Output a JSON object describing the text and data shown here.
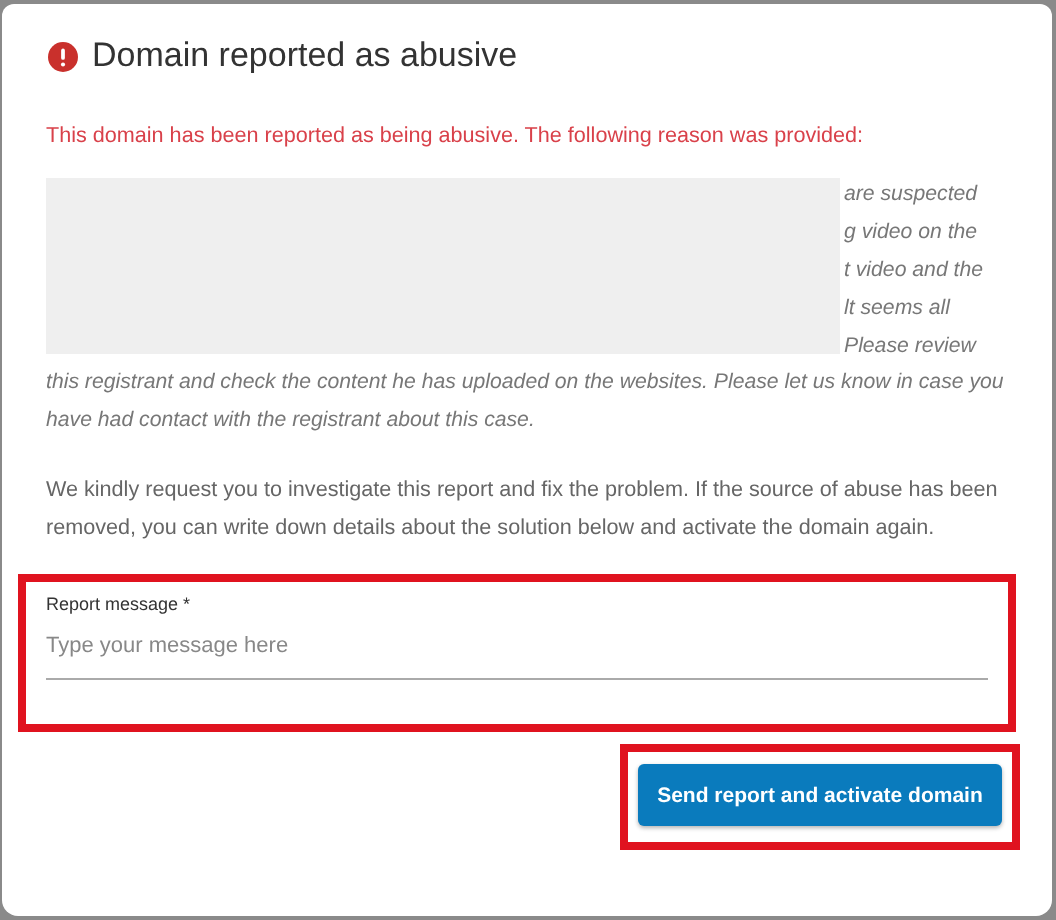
{
  "dialog": {
    "title": "Domain reported as abusive"
  },
  "notice": "This domain has been reported as being abusive. The following reason was provided:",
  "reason": {
    "redacted": true,
    "fragments": [
      "are suspected",
      "g video on the",
      "t video and the",
      "lt seems all",
      "Please review"
    ],
    "continued": "this registrant and check the content he has uploaded on the websites. Please let us know in case you have had contact with the registrant about this case."
  },
  "request": "We kindly request you to investigate this report and fix the problem. If the source of abuse has been removed, you can write down details about the solution below and activate the domain again.",
  "field": {
    "label": "Report message *",
    "placeholder": "Type your message here",
    "highlighted": true
  },
  "button": {
    "label": "Send report and activate domain",
    "highlighted": true
  }
}
